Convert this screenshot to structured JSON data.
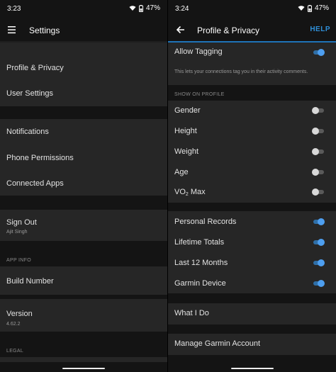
{
  "left": {
    "status_time": "3:23",
    "battery": "47%",
    "title": "Settings",
    "items": {
      "profile_privacy": "Profile & Privacy",
      "user_settings": "User Settings",
      "notifications": "Notifications",
      "phone_permissions": "Phone Permissions",
      "connected_apps": "Connected Apps",
      "sign_out": "Sign Out",
      "sign_out_user": "Ajit Singh",
      "build_number": "Build Number",
      "version": "Version",
      "version_value": "4.62.2"
    },
    "sections": {
      "app_info": "APP INFO",
      "legal": "LEGAL"
    }
  },
  "right": {
    "status_time": "3:24",
    "battery": "47%",
    "title": "Profile & Privacy",
    "help": "HELP",
    "allow_tagging": "Allow Tagging",
    "allow_tagging_note": "This lets your connections tag you in their activity comments.",
    "show_on_profile": "SHOW ON PROFILE",
    "profile_fields": {
      "gender": "Gender",
      "height": "Height",
      "weight": "Weight",
      "age": "Age",
      "vo2_prefix": "VO",
      "vo2_sub": "2",
      "vo2_suffix": " Max"
    },
    "stats": {
      "personal_records": "Personal Records",
      "lifetime_totals": "Lifetime Totals",
      "last_12_months": "Last 12 Months",
      "garmin_device": "Garmin Device"
    },
    "what_i_do": "What I Do",
    "manage_account": "Manage Garmin Account"
  },
  "toggles": {
    "allow_tagging": true,
    "gender": false,
    "height": false,
    "weight": false,
    "age": false,
    "vo2_max": false,
    "personal_records": true,
    "lifetime_totals": true,
    "last_12_months": true,
    "garmin_device": true
  },
  "colors": {
    "accent": "#1e73b8",
    "toggle_on": "#4e9ff0",
    "help_text": "#2f8fd8",
    "row_background": "#262626",
    "background": "#141414"
  }
}
